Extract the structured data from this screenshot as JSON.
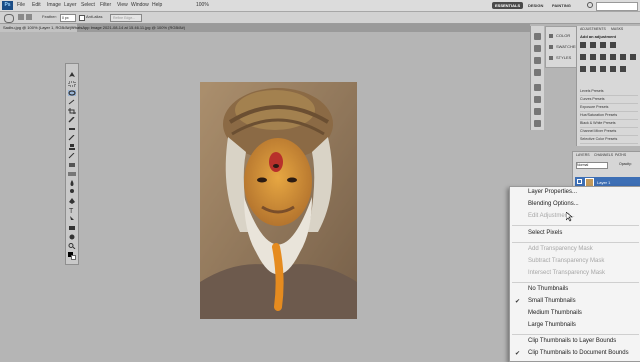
{
  "menubar": {
    "logo": "Ps",
    "items": [
      "File",
      "Edit",
      "Image",
      "Layer",
      "Select",
      "Filter",
      "View",
      "Window",
      "Help"
    ],
    "zoom": "100%",
    "workspaces": [
      "ESSENTIALS",
      "DESIGN",
      "PAINTING"
    ]
  },
  "options": {
    "feather_label": "Feather:",
    "feather_value": "0 px",
    "antialias_label": "Anti-alias",
    "refine_label": "Refine Edge..."
  },
  "doc_tabs": [
    "Sadhu.jpg @ 100% (Layer 1, RGB/8#) *",
    "WhatsApp Image 2021-08-14 at 15.46.11.jpg @ 100% (RGB/8#)"
  ],
  "panel_swatch": {
    "items": [
      "COLOR",
      "SWATCHES",
      "STYLES"
    ]
  },
  "adjustments": {
    "tabs": [
      "ADJUSTMENTS",
      "MASKS"
    ],
    "title": "Add an adjustment",
    "presets": [
      "Levels Presets",
      "Curves Presets",
      "Exposure Presets",
      "Hue/Saturation Presets",
      "Black & White Presets",
      "Channel Mixer Presets",
      "Selective Color Presets"
    ]
  },
  "layers": {
    "tabs": [
      "LAYERS",
      "CHANNELS",
      "PATHS"
    ],
    "blend": "Normal",
    "opacity_label": "Opacity:",
    "layer_name": "Layer 1"
  },
  "context_menu": {
    "items": [
      {
        "label": "Layer Properties...",
        "enabled": true
      },
      {
        "label": "Blending Options...",
        "enabled": true
      },
      {
        "label": "Edit Adjustment...",
        "enabled": false
      },
      {
        "label": "Select Pixels",
        "enabled": true
      },
      {
        "label": "Add Transparency Mask",
        "enabled": false
      },
      {
        "label": "Subtract Transparency Mask",
        "enabled": false
      },
      {
        "label": "Intersect Transparency Mask",
        "enabled": false
      },
      {
        "label": "No Thumbnails",
        "enabled": true
      },
      {
        "label": "Small Thumbnails",
        "enabled": true,
        "checked": true
      },
      {
        "label": "Medium Thumbnails",
        "enabled": true
      },
      {
        "label": "Large Thumbnails",
        "enabled": true
      },
      {
        "label": "Clip Thumbnails to Layer Bounds",
        "enabled": true
      },
      {
        "label": "Clip Thumbnails to Document Bounds",
        "enabled": true,
        "checked": true
      }
    ]
  }
}
